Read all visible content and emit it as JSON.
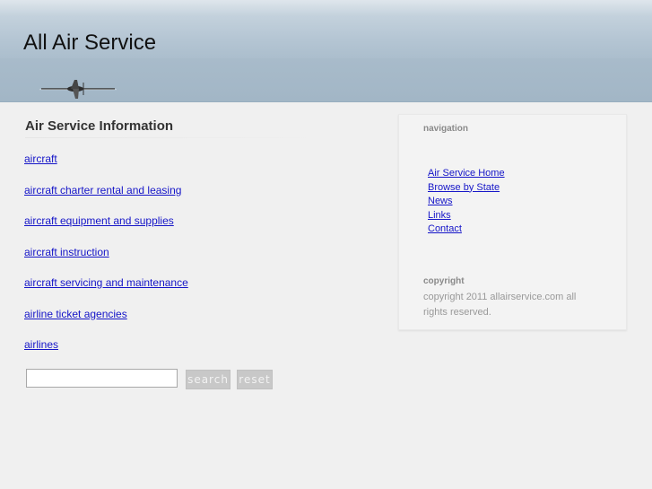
{
  "header": {
    "title": "All Air Service"
  },
  "main": {
    "heading": "Air Service Information",
    "categories": [
      "aircraft",
      "aircraft charter rental and leasing",
      "aircraft equipment and supplies",
      "aircraft instruction",
      "aircraft servicing and maintenance",
      "airline ticket agencies",
      "airlines"
    ]
  },
  "search": {
    "value": "",
    "search_label": "search",
    "reset_label": "reset"
  },
  "sidebar": {
    "nav_heading": "navigation",
    "nav_items": [
      "Air Service Home",
      "Browse by State",
      "News",
      "Links",
      "Contact"
    ],
    "copyright_heading": "copyright",
    "copyright_text": "copyright 2011 allairservice.com all rights reserved."
  }
}
